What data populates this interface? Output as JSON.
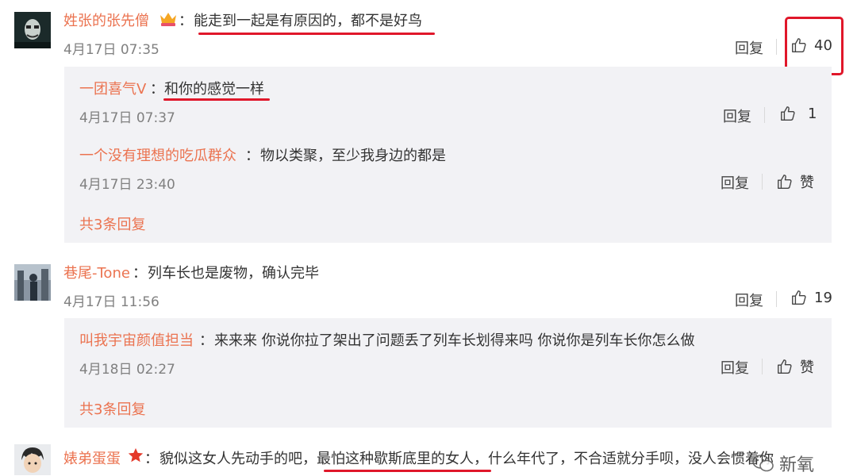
{
  "comments": [
    {
      "user": "姓张的张先僧",
      "badge": "crown-badge-icon",
      "sep": "：",
      "text": "能走到一起是有原因的，都不是好鸟",
      "time": "4月17日 07:35",
      "reply_label": "回复",
      "likes": "40",
      "replies": [
        {
          "user": "一团喜气V",
          "sep": "：",
          "text": "和你的感觉一样",
          "time": "4月17日 07:37",
          "reply_label": "回复",
          "likes": "1"
        },
        {
          "user": "一个没有理想的吃瓜群众",
          "sep": "：",
          "text": "物以类聚，至少我身边的都是",
          "time": "4月17日 23:40",
          "reply_label": "回复",
          "likes": "赞"
        }
      ],
      "more": "共3条回复"
    },
    {
      "user": "巷尾-Tone",
      "sep": "：",
      "text": "列车长也是废物，确认完毕",
      "time": "4月17日 11:56",
      "reply_label": "回复",
      "likes": "19",
      "replies": [
        {
          "user": "叫我宇宙颜值担当",
          "sep": "：",
          "text": "来来来 你说你拉了架出了问题丢了列车长划得来吗 你说你是列车长你怎么做",
          "time": "4月18日 02:27",
          "reply_label": "回复",
          "likes": "赞"
        }
      ],
      "more": "共3条回复"
    },
    {
      "user": "婊弟蛋蛋",
      "badge": "star-badge-icon",
      "sep": "：",
      "text": "貌似这女人先动手的吧，最怕这种歇斯底里的女人，什么年代了，不合适就分手呗，没人会惯着你"
    }
  ],
  "watermark": "新氧",
  "colors": {
    "username": "#eb7350",
    "annotation": "#e0172a",
    "reply_bg": "#f2f2f5"
  }
}
